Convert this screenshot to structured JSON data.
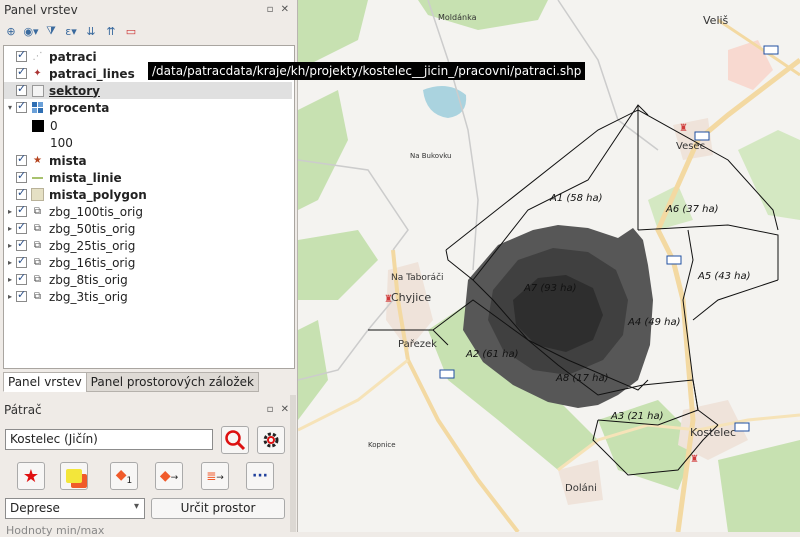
{
  "layers_panel": {
    "title": "Panel vrstev",
    "buttons": "▫ ✕",
    "toolbar_icons": [
      "add-group-icon",
      "eye-icon",
      "filter-icon",
      "expression-filter-icon",
      "expand-all-icon",
      "collapse-all-icon",
      "remove-layer-icon"
    ],
    "layers": [
      {
        "label": "patraci",
        "bold": true,
        "icon": "point-icon",
        "checked": true
      },
      {
        "label": "patraci_lines",
        "bold": true,
        "icon": "line-point-icon",
        "checked": true
      },
      {
        "label": "sektory",
        "bold": true,
        "icon": "polygon-icon",
        "checked": true,
        "selected": true
      },
      {
        "label": "procenta",
        "bold": true,
        "icon": "raster-icon",
        "checked": true,
        "expanded": true
      },
      {
        "label": "mista",
        "bold": true,
        "icon": "star-icon",
        "checked": true
      },
      {
        "label": "mista_linie",
        "bold": true,
        "icon": "line-icon",
        "checked": true
      },
      {
        "label": "mista_polygon",
        "bold": true,
        "icon": "polygon-fill-icon",
        "checked": true
      },
      {
        "label": "zbg_100tis_orig",
        "bold": false,
        "icon": "wms-icon",
        "checked": true
      },
      {
        "label": "zbg_50tis_orig",
        "bold": false,
        "icon": "wms-icon",
        "checked": true
      },
      {
        "label": "zbg_25tis_orig",
        "bold": false,
        "icon": "wms-icon",
        "checked": true
      },
      {
        "label": "zbg_16tis_orig",
        "bold": false,
        "icon": "wms-icon",
        "checked": true
      },
      {
        "label": "zbg_8tis_orig",
        "bold": false,
        "icon": "wms-icon",
        "checked": true
      },
      {
        "label": "zbg_3tis_orig",
        "bold": false,
        "icon": "wms-icon",
        "checked": true
      }
    ],
    "legend_min": "0",
    "legend_max": "100",
    "tooltip": "/data/patracdata/kraje/kh/projekty/kostelec__jicin_/pracovni/patraci.shp"
  },
  "tabs": [
    "Panel vrstev",
    "Panel prostorových záložek"
  ],
  "search_panel": {
    "title": "Pátrač",
    "buttons": "▫ ✕",
    "place_value": "Kostelec (Jičín)",
    "action_icons": [
      "star-icon",
      "yellow-sector-icon",
      "one-person-icon",
      "move-person-icon",
      "calculate-list-icon",
      "more-icon"
    ],
    "type_select": "Deprese",
    "determine_button": "Určit prostor",
    "cut_label": "Hodnoty min/max"
  },
  "map": {
    "sectors": [
      {
        "label": "A1 (58 ha)"
      },
      {
        "label": "A6 (37 ha)"
      },
      {
        "label": "A5 (43 ha)"
      },
      {
        "label": "A7 (93 ha)"
      },
      {
        "label": "A4 (49 ha)"
      },
      {
        "label": "A2 (61 ha)"
      },
      {
        "label": "A8 (17 ha)"
      },
      {
        "label": "A3 (21 ha)"
      }
    ],
    "places": [
      "Moldánka",
      "Veliš",
      "Vesec",
      "Na Taboráči",
      "Chyjice",
      "Pařezek",
      "Kostelec",
      "Doláni",
      "Na Bukovku",
      "Kopnice"
    ],
    "colors": {
      "green": "#c7e1b1",
      "road": "#f3d9a2",
      "dark": "#4d4d4d"
    }
  }
}
